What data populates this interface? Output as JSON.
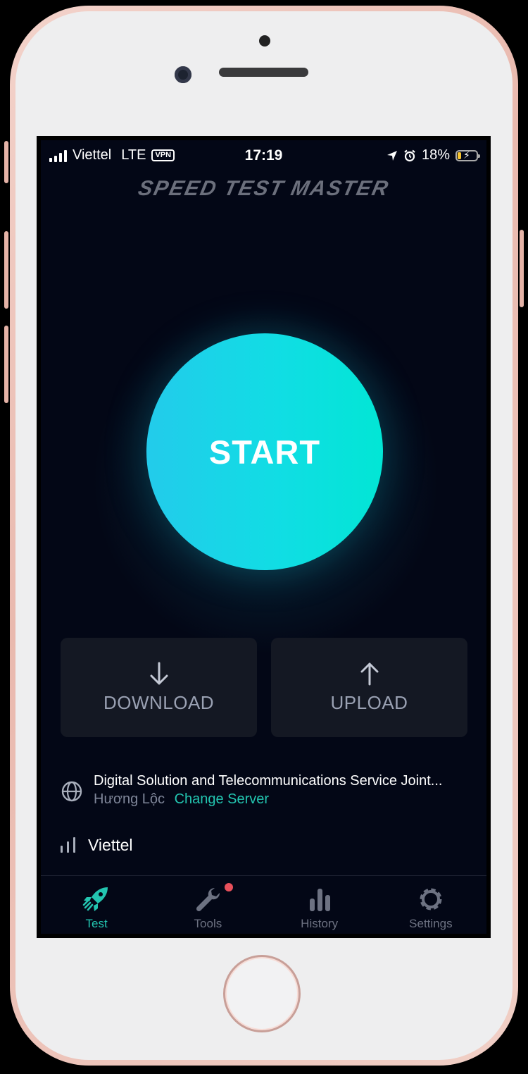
{
  "status_bar": {
    "carrier": "Viettel",
    "network": "LTE",
    "vpn": "VPN",
    "time": "17:19",
    "battery": "18%",
    "battery_level": 0.18
  },
  "app": {
    "logo_text": "SPEED TEST MASTER"
  },
  "start_button": {
    "label": "START"
  },
  "metrics": {
    "download": {
      "label": "DOWNLOAD",
      "icon": "arrow-down-icon"
    },
    "upload": {
      "label": "UPLOAD",
      "icon": "arrow-up-icon"
    }
  },
  "server": {
    "name": "Digital Solution and Telecommunications Service Joint...",
    "location": "Hương Lộc",
    "change_label": "Change Server",
    "icon": "globe-icon"
  },
  "network": {
    "carrier": "Viettel",
    "icon": "signal-bars-icon"
  },
  "tabs": [
    {
      "label": "Test",
      "icon": "rocket-icon",
      "active": true
    },
    {
      "label": "Tools",
      "icon": "wrench-icon",
      "badge": true
    },
    {
      "label": "History",
      "icon": "bar-chart-icon"
    },
    {
      "label": "Settings",
      "icon": "gear-icon"
    }
  ],
  "colors": {
    "accent": "#23c5b0",
    "start_gradient_left": "#23cbeb",
    "start_gradient_right": "#02e6d5",
    "background": "#030716",
    "card": "#141823",
    "badge": "#e8505b"
  }
}
